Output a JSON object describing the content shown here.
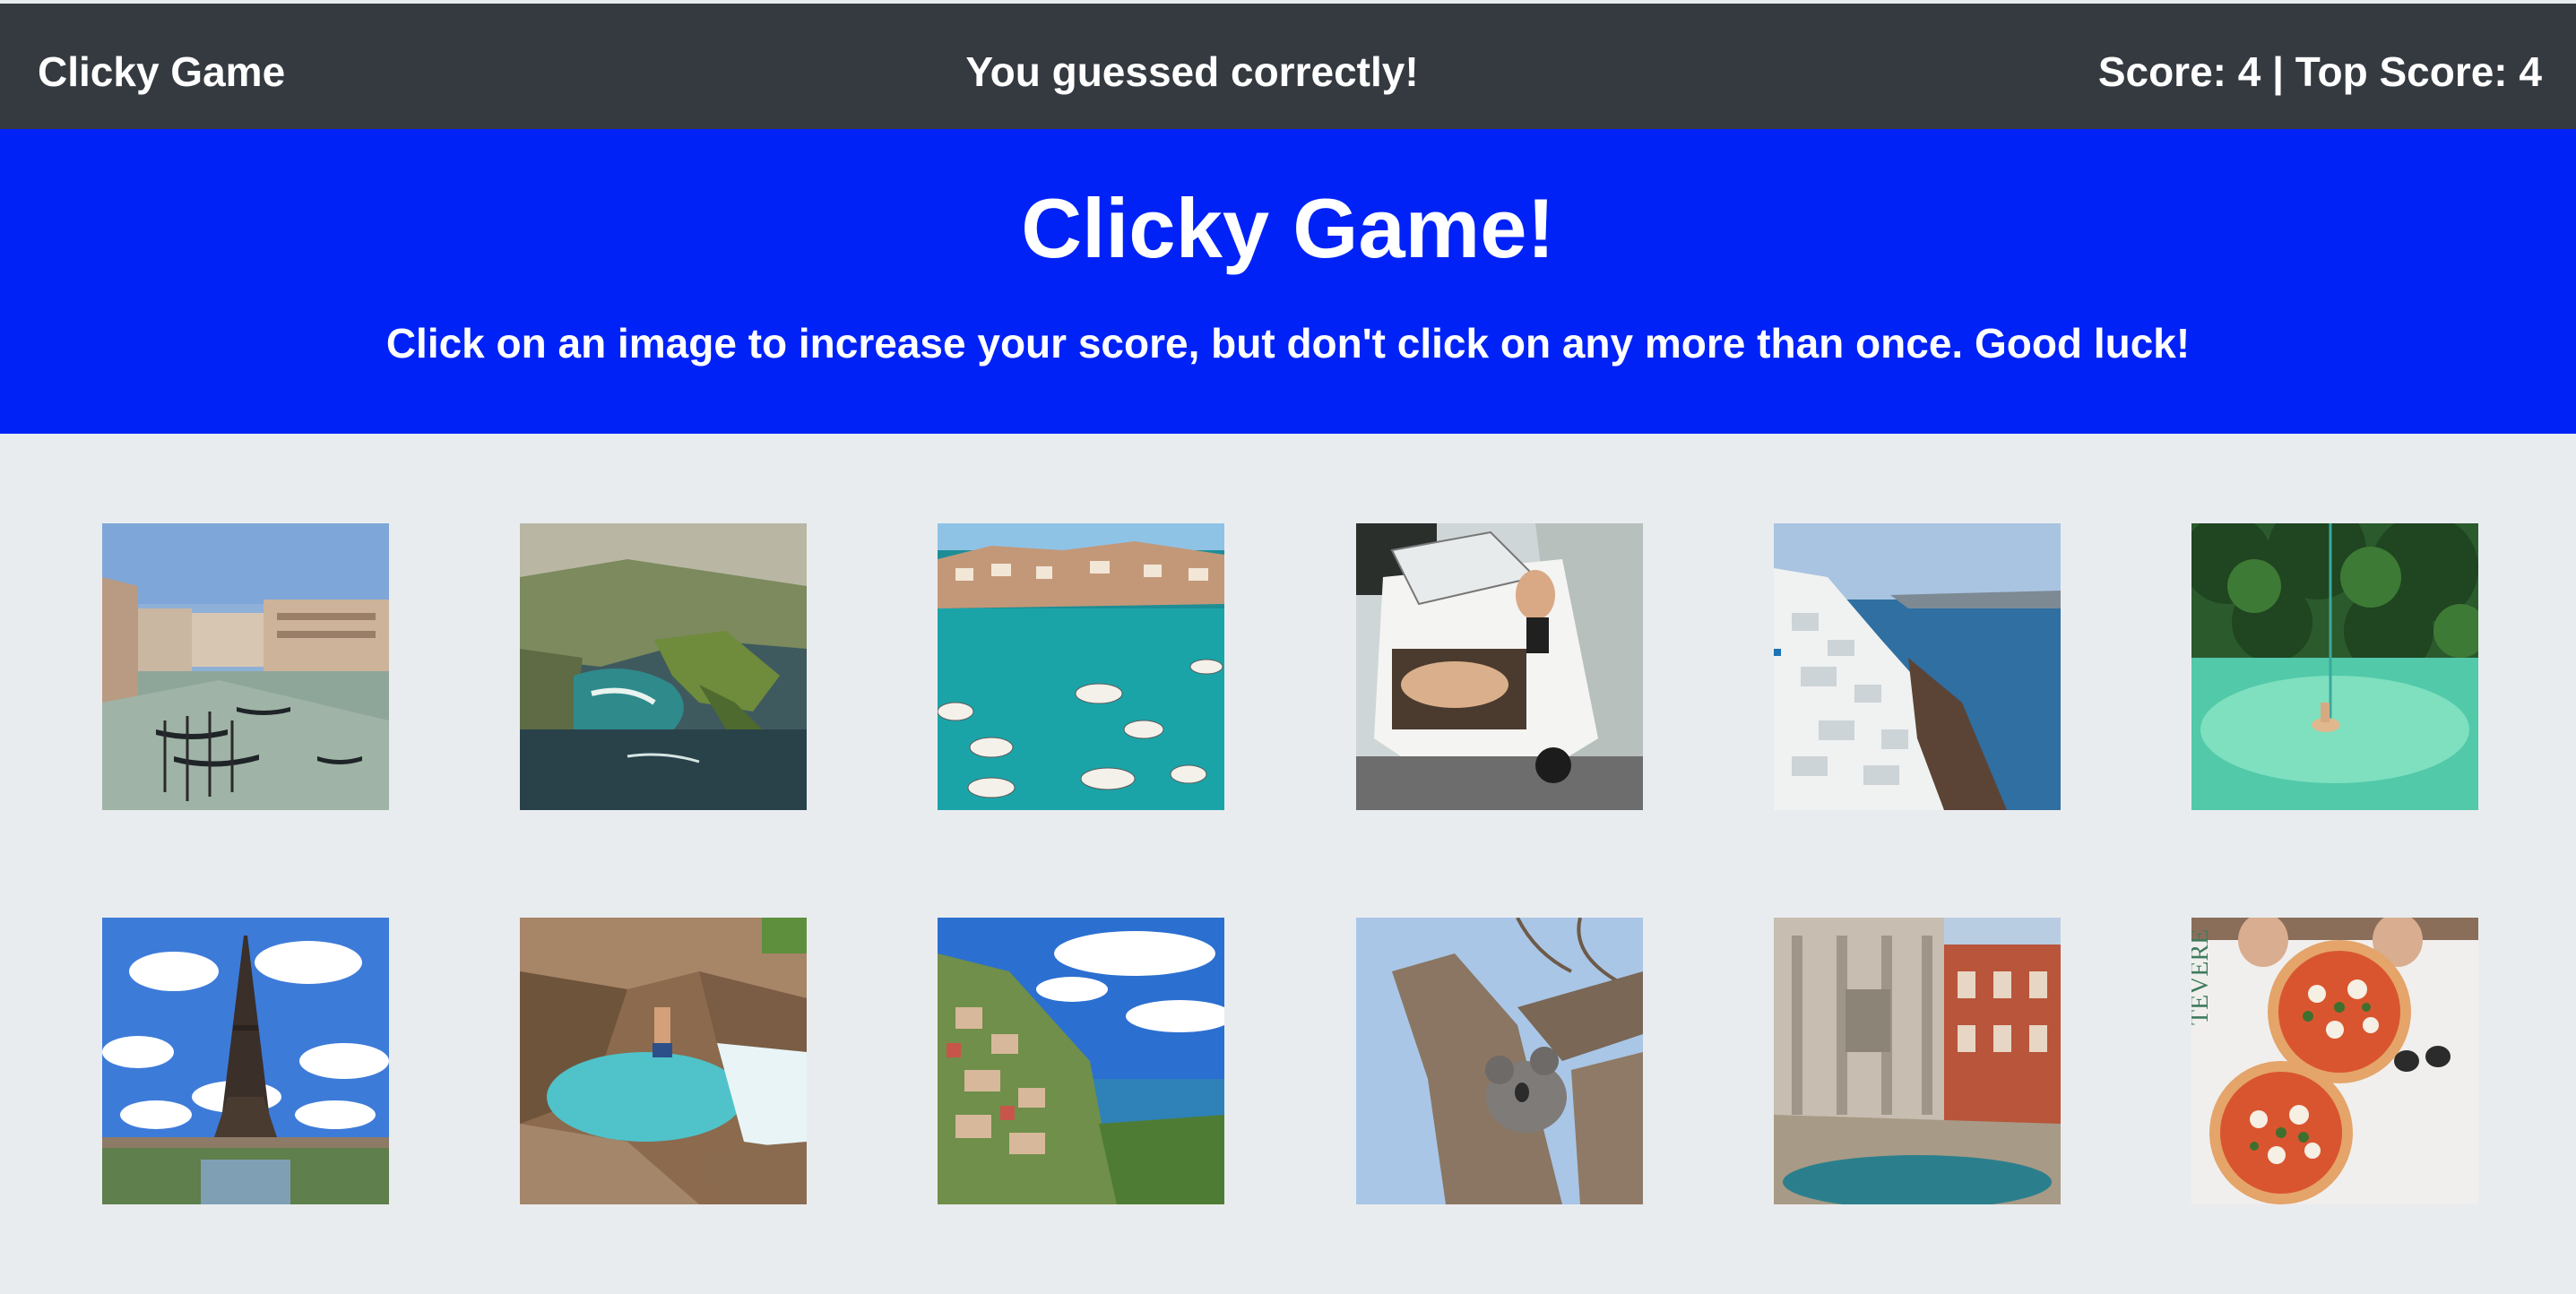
{
  "nav": {
    "brand": "Clicky Game",
    "message": "You guessed correctly!",
    "score_label": "Score:",
    "score": "4",
    "separator": "|",
    "top_score_label": "Top Score:",
    "top_score": "4"
  },
  "hero": {
    "title": "Clicky Game!",
    "instructions": "Click on an image to increase your score, but don't click on any more than once. Good luck!"
  },
  "colors": {
    "navbar": "#343a40",
    "hero": "#0022f7",
    "background": "#e9ecef",
    "text": "#ffffff"
  },
  "images": [
    {
      "name": "venice-grand-canal-image"
    },
    {
      "name": "coastal-cliffs-aerial-image"
    },
    {
      "name": "harbor-boats-image"
    },
    {
      "name": "vintage-van-friends-image"
    },
    {
      "name": "santorini-cliffside-image"
    },
    {
      "name": "jungle-lagoon-swing-image"
    },
    {
      "name": "eiffel-tower-image"
    },
    {
      "name": "waterfall-jump-image"
    },
    {
      "name": "amalfi-coast-image"
    },
    {
      "name": "koala-in-tree-image"
    },
    {
      "name": "trevi-fountain-image"
    },
    {
      "name": "pizza-table-image"
    }
  ]
}
